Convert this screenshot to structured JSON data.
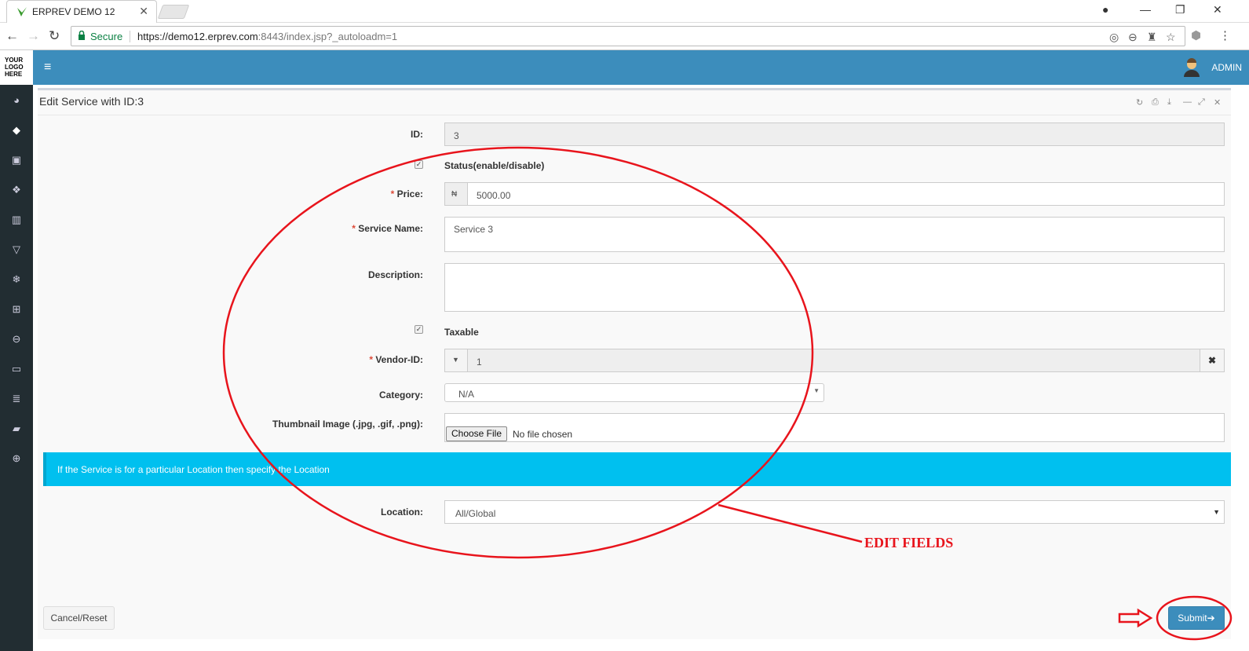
{
  "browser": {
    "tab_title": "ERPREV DEMO 12",
    "secure_label": "Secure",
    "url_main": "https://demo12.erprev.com",
    "url_rest": ":8443/index.jsp?_autoloadm=1"
  },
  "logo": [
    "YOUR",
    "LOGO",
    "HERE"
  ],
  "topbar": {
    "user_label": "ADMIN"
  },
  "panel": {
    "title": "Edit Service with ID:3"
  },
  "form": {
    "id_label": "ID:",
    "id_value": "3",
    "status_label": "Status(enable/disable)",
    "price_label": "Price:",
    "price_prefix": "₦",
    "price_value": "5000.00",
    "service_name_label": "Service Name:",
    "service_name_value": "Service 3",
    "description_label": "Description:",
    "description_value": "",
    "taxable_label": "Taxable",
    "vendor_label": "Vendor-ID:",
    "vendor_value": "1",
    "category_label": "Category:",
    "category_value": "N/A",
    "thumbnail_label": "Thumbnail Image (.jpg, .gif, .png):",
    "choose_file_label": "Choose File",
    "no_file_label": "No file chosen",
    "info_text": "If the Service is for a particular Location then specify the Location",
    "location_label": "Location:",
    "location_value": "All/Global",
    "required_marker": "*"
  },
  "buttons": {
    "cancel": "Cancel/Reset",
    "submit": "Submit"
  },
  "annotation": {
    "label": "EDIT FIELDS",
    "color": "#e8141c"
  },
  "colors": {
    "topbar": "#3c8dbc",
    "sidebar": "#222d32",
    "info": "#00c0ef"
  }
}
